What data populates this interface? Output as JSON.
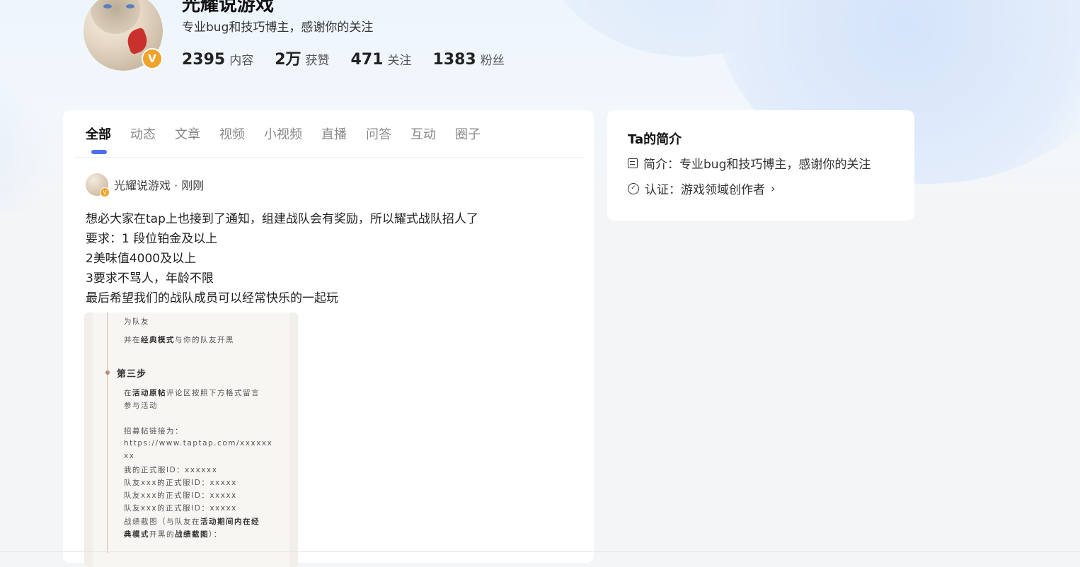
{
  "profile": {
    "name": "光耀说游戏",
    "bio": "专业bug和技巧博主，感谢你的关注",
    "badge": "V",
    "stats": [
      {
        "value": "2395",
        "label": "内容"
      },
      {
        "value": "2万",
        "label": "获赞"
      },
      {
        "value": "471",
        "label": "关注"
      },
      {
        "value": "1383",
        "label": "粉丝"
      }
    ]
  },
  "tabs": [
    "全部",
    "动态",
    "文章",
    "视频",
    "小视频",
    "直播",
    "问答",
    "互动",
    "圈子"
  ],
  "post": {
    "meta": "光耀说游戏 · 刚刚",
    "lines": [
      "想必大家在tap上也接到了通知，组建战队会有奖励，所以耀式战队招人了",
      "要求：1 段位铂金及以上",
      "2美味值4000及以上",
      "3要求不骂人，年龄不限",
      "最后希望我们的战队成员可以经常快乐的一起玩"
    ],
    "image": {
      "line1": "为队友",
      "line2_pre": "并在",
      "line2_bold": "经典模式",
      "line2_post": "与你的队友开黑",
      "step": "第三步",
      "line3_pre": "在",
      "line3_bold": "活动原帖",
      "line3_post": "评论区按照下方格式留言",
      "line4": "参与活动",
      "line5": "招募帖链接为：",
      "line6": "https://www.taptap.com/xxxxxx",
      "line7": "xx",
      "line8": "我的正式服ID：xxxxxx",
      "line9": "队友xxx的正式服ID：xxxxx",
      "line10": "队友xxx的正式服ID：xxxxx",
      "line11": "队友xxx的正式服ID：xxxxx",
      "line12_pre": "战绩截图（与队友在",
      "line12_bold": "活动期间内在经",
      "line13_bold1": "典模式",
      "line13_mid": "开黑的",
      "line13_bold2": "战绩截图",
      "line13_post": "）："
    }
  },
  "sidebar": {
    "title": "Ta的简介",
    "intro": "简介：专业bug和技巧博主，感谢你的关注",
    "cert": "认证：游戏领域创作者"
  }
}
